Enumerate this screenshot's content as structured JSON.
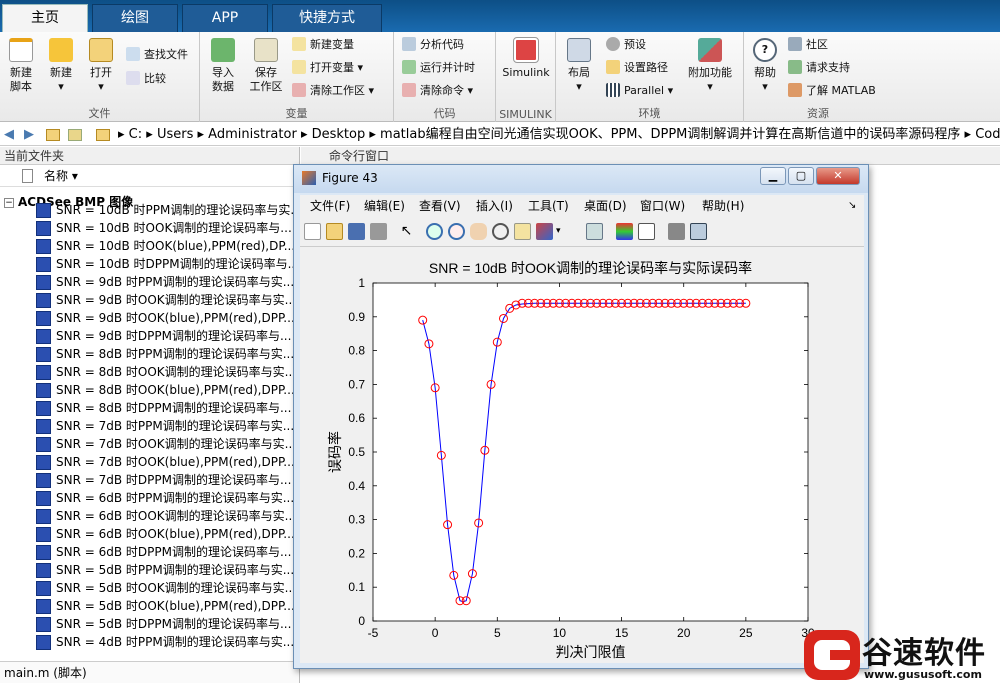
{
  "tabs": {
    "home": "主页",
    "plot": "绘图",
    "app": "APP",
    "shortcut": "快捷方式"
  },
  "ribbon": {
    "new_script": "新建\n脚本",
    "new": "新建",
    "open": "打开",
    "find_files": "查找文件",
    "compare": "比较",
    "import_data": "导入\n数据",
    "save_workspace": "保存\n工作区",
    "new_variable": "新建变量",
    "open_variable": "打开变量",
    "clear_workspace": "清除工作区",
    "analyze_code": "分析代码",
    "run_and_time": "运行并计时",
    "clear_commands": "清除命令",
    "simulink": "Simulink",
    "layout": "布局",
    "preferences": "预设",
    "set_path": "设置路径",
    "parallel": "Parallel",
    "addons": "附加功能",
    "help": "帮助",
    "community": "社区",
    "request_support": "请求支持",
    "learn_matlab": "了解 MATLAB",
    "group_file": "文件",
    "group_variable": "变量",
    "group_code": "代码",
    "group_simulink": "SIMULINK",
    "group_env": "环境",
    "group_resources": "资源"
  },
  "path": [
    "C:",
    "Users",
    "Administrator",
    "Desktop",
    "matlab编程自由空间光通信实现OOK、PPM、DPPM调制解调并计算在高斯信道中的误码率源码程序",
    "Code"
  ],
  "current_folder": {
    "title": "当前文件夹",
    "name_col": "名称 ▾",
    "group_label": "ACDSee BMP 图像",
    "files": [
      "SNR = 10dB 时PPM调制的理论误码率与实...",
      "SNR = 10dB 时OOK调制的理论误码率与...",
      "SNR = 10dB 时OOK(blue),PPM(red),DP...",
      "SNR = 10dB 时DPPM调制的理论误码率与...",
      "SNR = 9dB 时PPM调制的理论误码率与实...",
      "SNR = 9dB 时OOK调制的理论误码率与实...",
      "SNR = 9dB 时OOK(blue),PPM(red),DPP...",
      "SNR = 9dB 时DPPM调制的理论误码率与...",
      "SNR = 8dB 时PPM调制的理论误码率与实...",
      "SNR = 8dB 时OOK调制的理论误码率与实...",
      "SNR = 8dB 时OOK(blue),PPM(red),DPP...",
      "SNR = 8dB 时DPPM调制的理论误码率与...",
      "SNR = 7dB 时PPM调制的理论误码率与实...",
      "SNR = 7dB 时OOK调制的理论误码率与实...",
      "SNR = 7dB 时OOK(blue),PPM(red),DPP...",
      "SNR = 7dB 时DPPM调制的理论误码率与...",
      "SNR = 6dB 时PPM调制的理论误码率与实...",
      "SNR = 6dB 时OOK调制的理论误码率与实...",
      "SNR = 6dB 时OOK(blue),PPM(red),DPP...",
      "SNR = 6dB 时DPPM调制的理论误码率与...",
      "SNR = 5dB 时PPM调制的理论误码率与实...",
      "SNR = 5dB 时OOK调制的理论误码率与实...",
      "SNR = 5dB 时OOK(blue),PPM(red),DPP...",
      "SNR = 5dB 时DPPM调制的理论误码率与...",
      "SNR = 4dB 时PPM调制的理论误码率与实..."
    ],
    "status": "main.m  (脚本)"
  },
  "command_window": {
    "title": "命令行窗口"
  },
  "figure": {
    "title": "Figure 43",
    "menu": [
      "文件(F)",
      "编辑(E)",
      "查看(V)",
      "插入(I)",
      "工具(T)",
      "桌面(D)",
      "窗口(W)",
      "帮助(H)"
    ]
  },
  "chart_data": {
    "type": "line",
    "title": "SNR = 10dB 时OOK调制的理论误码率与实际误码率",
    "xlabel": "判决门限值",
    "ylabel": "误码率",
    "xlim": [
      -5,
      30
    ],
    "ylim": [
      0,
      1
    ],
    "xticks": [
      -5,
      0,
      5,
      10,
      15,
      20,
      25,
      30
    ],
    "yticks": [
      0,
      0.1,
      0.2,
      0.3,
      0.4,
      0.5,
      0.6,
      0.7,
      0.8,
      0.9,
      1
    ],
    "series": [
      {
        "style": "line",
        "color": "#0000ff",
        "x": [
          -1,
          -0.5,
          0,
          0.5,
          1,
          1.5,
          2,
          2.25,
          2.5,
          3,
          3.5,
          4,
          4.5,
          5,
          5.5,
          6,
          6.5,
          7,
          8,
          10,
          25
        ],
        "y": [
          0.89,
          0.82,
          0.69,
          0.49,
          0.285,
          0.135,
          0.06,
          0.057,
          0.06,
          0.14,
          0.29,
          0.505,
          0.7,
          0.825,
          0.895,
          0.925,
          0.935,
          0.938,
          0.94,
          0.94,
          0.94
        ]
      },
      {
        "style": "markers",
        "color": "#ff0000",
        "x": [
          -1,
          -0.5,
          0,
          0.5,
          1,
          1.5,
          2,
          2.5,
          3,
          3.5,
          4,
          4.5,
          5,
          5.5,
          6,
          6.5,
          7,
          7.5,
          8,
          8.5,
          9,
          9.5,
          10,
          10.5,
          11,
          11.5,
          12,
          12.5,
          13,
          13.5,
          14,
          14.5,
          15,
          15.5,
          16,
          16.5,
          17,
          17.5,
          18,
          18.5,
          19,
          19.5,
          20,
          20.5,
          21,
          21.5,
          22,
          22.5,
          23,
          23.5,
          24,
          24.5,
          25
        ],
        "y": [
          0.89,
          0.82,
          0.69,
          0.49,
          0.285,
          0.135,
          0.06,
          0.06,
          0.14,
          0.29,
          0.505,
          0.7,
          0.825,
          0.895,
          0.925,
          0.935,
          0.94,
          0.94,
          0.94,
          0.94,
          0.94,
          0.94,
          0.94,
          0.94,
          0.94,
          0.94,
          0.94,
          0.94,
          0.94,
          0.94,
          0.94,
          0.94,
          0.94,
          0.94,
          0.94,
          0.94,
          0.94,
          0.94,
          0.94,
          0.94,
          0.94,
          0.94,
          0.94,
          0.94,
          0.94,
          0.94,
          0.94,
          0.94,
          0.94,
          0.94,
          0.94,
          0.94,
          0.94
        ]
      }
    ]
  },
  "watermark": {
    "brand": "谷速软件",
    "url": "www.gususoft.com"
  }
}
